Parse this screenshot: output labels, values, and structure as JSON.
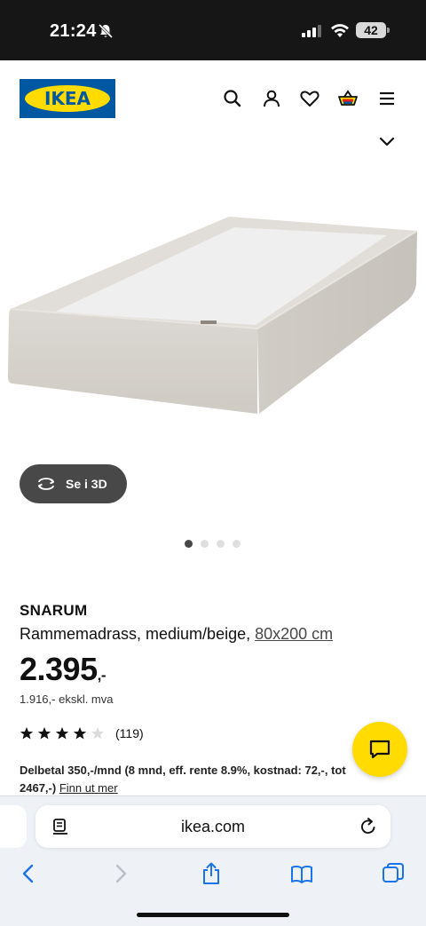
{
  "status_bar": {
    "time": "21:24",
    "battery": "42"
  },
  "header": {
    "logo_text": "IKEA"
  },
  "gallery": {
    "view_3d_label": "Se i 3D",
    "image_count": 4,
    "active_index": 0
  },
  "product": {
    "name": "SNARUM",
    "description": "Rammemadrass, medium/beige,",
    "size_link": "80x200 cm",
    "price": "2.395",
    "price_suffix": ",-",
    "price_ex_vat": "1.916,- ekskl. mva",
    "rating_value": 4,
    "rating_count": "(119)",
    "installment_text": "Delbetal 350,-/mnd (8 mnd, eff. rente 8.9%, kostnad: 72,-, tot 2467,-)",
    "installment_link": "Finn ut mer"
  },
  "browser": {
    "url": "ikea.com"
  },
  "colors": {
    "ikea_blue": "#0058a3",
    "ikea_yellow": "#ffdb00",
    "dark_button": "#484848"
  }
}
